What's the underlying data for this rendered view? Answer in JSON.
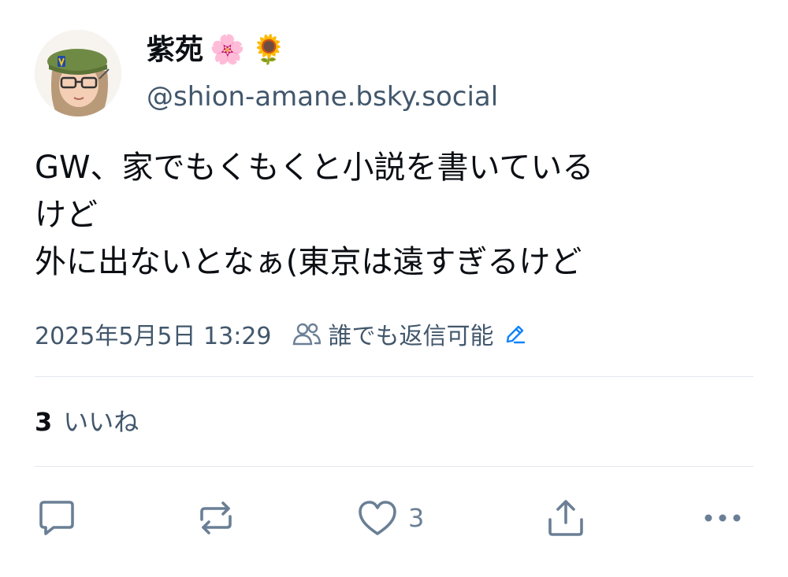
{
  "author": {
    "display_name": "紫苑",
    "emojis": [
      "🌸",
      "🌻"
    ],
    "handle": "@shion-amane.bsky.social",
    "avatar": "avatar-illustration"
  },
  "post": {
    "text": "GW、家でもくもくと小説を書いている\nけど\n外に出ないとなぁ(東京は遠すぎるけど"
  },
  "meta": {
    "timestamp": "2025年5月5日 13:29",
    "reply_setting": "誰でも返信可能",
    "icons": [
      "people-icon",
      "edit-pencil-icon"
    ]
  },
  "stats": {
    "likes_count": "3",
    "likes_label": "いいね"
  },
  "actions": {
    "reply_icon": "comment-icon",
    "repost_icon": "repost-icon",
    "like_icon": "heart-icon",
    "like_count": "3",
    "share_icon": "share-icon",
    "more_icon": "more-icon"
  },
  "colors": {
    "text": "#0b0f14",
    "muted": "#42576c",
    "icon": "#6a7f95",
    "accent": "#1083fe",
    "divider": "#e3e8ee"
  }
}
